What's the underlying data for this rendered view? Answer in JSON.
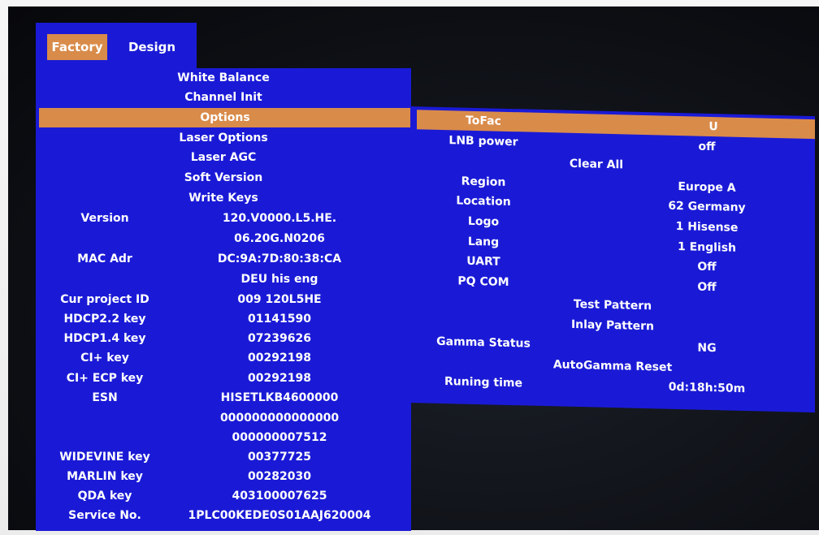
{
  "tabs": {
    "factory": "Factory",
    "design": "Design"
  },
  "left_menu": {
    "items": [
      "White Balance",
      "Channel Init",
      "Options",
      "Laser Options",
      "Laser AGC",
      "Soft Version",
      "Write Keys"
    ],
    "selected_index": 2
  },
  "left_info": [
    {
      "label": "Version",
      "value": "120.V0000.L5.HE."
    },
    {
      "label": "",
      "value": "06.20G.N0206"
    },
    {
      "label": "MAC Adr",
      "value": "DC:9A:7D:80:38:CA"
    },
    {
      "label": "",
      "value": "DEU his eng"
    },
    {
      "label": "Cur project ID",
      "value": "009 120L5HE"
    },
    {
      "label": "HDCP2.2 key",
      "value": "01141590"
    },
    {
      "label": "HDCP1.4 key",
      "value": "07239626"
    },
    {
      "label": "CI+ key",
      "value": "00292198"
    },
    {
      "label": "CI+ ECP key",
      "value": "00292198"
    },
    {
      "label": "ESN",
      "value": "HISETLKB4600000"
    },
    {
      "label": "",
      "value": "000000000000000"
    },
    {
      "label": "",
      "value": "000000007512"
    },
    {
      "label": "WIDEVINE key",
      "value": "00377725"
    },
    {
      "label": "MARLIN key",
      "value": "00282030"
    },
    {
      "label": "QDA key",
      "value": "403100007625"
    },
    {
      "label": "Service No.",
      "value": "1PLC00KEDE0S01AAJ620004"
    }
  ],
  "right": {
    "tofac": {
      "label": "ToFac",
      "value": "U"
    },
    "lnb": {
      "label": "LNB power",
      "value": "off"
    },
    "clear_all": "Clear All",
    "region": {
      "label": "Region",
      "value": "Europe A"
    },
    "location": {
      "label": "Location",
      "value": "62 Germany"
    },
    "logo": {
      "label": "Logo",
      "value": "1 Hisense"
    },
    "lang": {
      "label": "Lang",
      "value": "1 English"
    },
    "uart": {
      "label": "UART",
      "value": "Off"
    },
    "pqcom": {
      "label": "PQ COM",
      "value": "Off"
    },
    "test_pattern": "Test  Pattern",
    "inlay_pattern": "Inlay  Pattern",
    "gamma": {
      "label": "Gamma Status",
      "value": "NG"
    },
    "autogamma": "AutoGamma Reset",
    "runtime": {
      "label": "Runing time",
      "value": "0d:18h:50m"
    }
  },
  "colors": {
    "panel_blue": "#1a1ad6",
    "highlight_orange": "#d98b4a",
    "text": "#ffffff"
  }
}
